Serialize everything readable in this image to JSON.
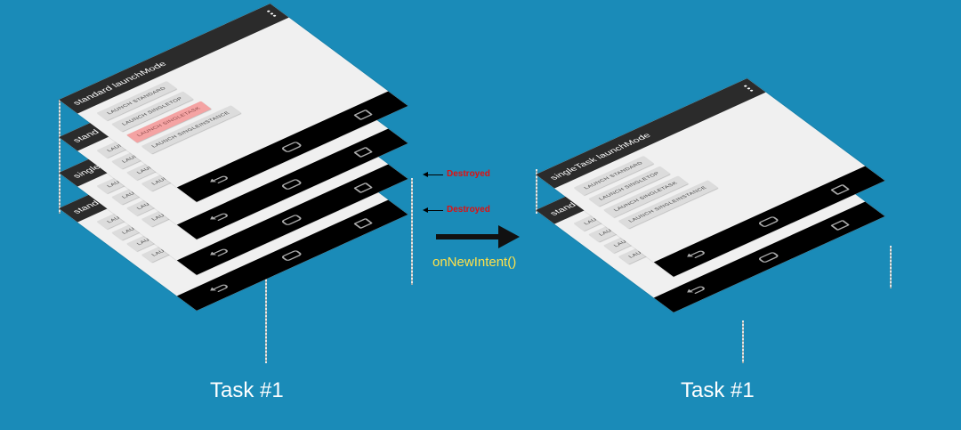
{
  "colors": {
    "background": "#1a8bb8",
    "destroyed_text": "#e01010",
    "intent_text": "#ffe14a",
    "highlight_button": "#f4a3a3"
  },
  "left_task": {
    "label": "Task #1",
    "stack": [
      {
        "title": "stand",
        "buttons": [
          "LAUNCH STANDARD",
          "LAUNCH SINGLETOP",
          "LAUNCH SINGLETASK",
          "LAUNCH SINGLEINSTANCE"
        ],
        "highlighted_index": -1
      },
      {
        "title": "single",
        "buttons": [
          "LAUNCH STANDARD",
          "LAUNCH SINGLETOP",
          "LAUNCH SINGLETASK",
          "LAUNCH SINGLEINSTANCE"
        ],
        "highlighted_index": -1
      },
      {
        "title": "stand",
        "buttons": [
          "LAUNCH STANDARD",
          "LAUNCH SINGLETOP",
          "LAUNCH SINGLETASK",
          "LAUNCH SINGLEINSTANCE"
        ],
        "highlighted_index": -1
      },
      {
        "title": "standard launchMode",
        "buttons": [
          "LAUNCH STANDARD",
          "LAUNCH SINGLETOP",
          "LAUNCH SINGLETASK",
          "LAUNCH SINGLEINSTANCE"
        ],
        "highlighted_index": 2
      }
    ]
  },
  "destroyed_labels": [
    "Destroyed",
    "Destroyed"
  ],
  "transition_label": "onNewIntent()",
  "right_task": {
    "label": "Task #1",
    "stack": [
      {
        "title": "stand",
        "buttons": [
          "LAUNCH STANDARD",
          "LAUNCH SINGLETOP",
          "LAUNCH SINGLETASK",
          "LAUNCH SINGLEINSTANCE"
        ],
        "highlighted_index": -1
      },
      {
        "title": "singleTask launchMode",
        "buttons": [
          "LAUNCH STANDARD",
          "LAUNCH SINGLETOP",
          "LAUNCH SINGLETASK",
          "LAUNCH SINGLEINSTANCE"
        ],
        "highlighted_index": -1
      }
    ]
  }
}
